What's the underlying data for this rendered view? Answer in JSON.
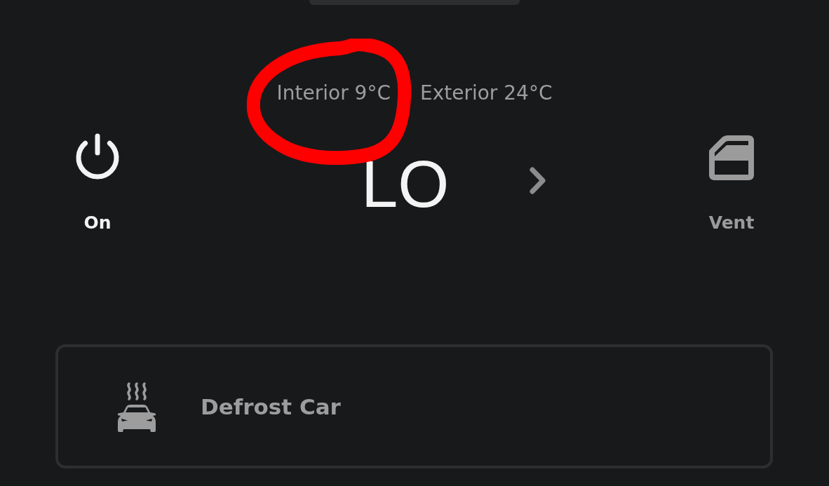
{
  "temperatures": [
    {
      "label": "Interior 9°C",
      "circled": true
    },
    {
      "label": "Exterior 24°C",
      "circled": false
    }
  ],
  "power": {
    "label": "On",
    "on": true
  },
  "setpoint": {
    "value": "LO"
  },
  "vent": {
    "label": "Vent",
    "on": false
  },
  "defrost": {
    "label": "Defrost Car"
  }
}
